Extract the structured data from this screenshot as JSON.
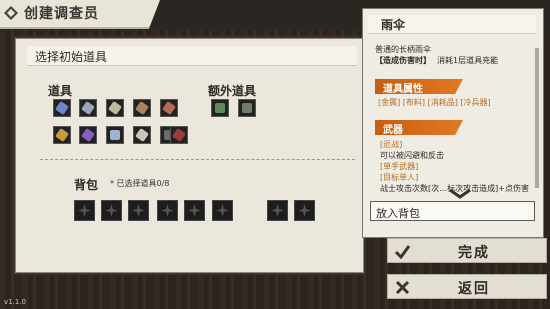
{
  "header": {
    "title": "创建调查员"
  },
  "left_panel": {
    "heading": "选择初始道具",
    "items_label": "道具",
    "extra_label": "额外道具",
    "bag_label": "背包",
    "bag_count": "* 已选择道具0/8"
  },
  "detail": {
    "name": "雨伞",
    "description": "普通的长柄雨伞",
    "effect_tag": "【造成伤害时】",
    "effect_text": "消耗1层道具充能",
    "attr_heading": "道具属性",
    "attr_tags": "[金属] [布料] [消耗品] [冷兵器]",
    "weapon_heading": "武器",
    "range_tag": "[近战]",
    "range_text": "可以被闪避和反击",
    "hand_tag": "[单手武器]",
    "target_tag": "[目标单人]",
    "partial_text": "战士攻击次数[次…标次攻击造成]+点伤害",
    "add_button": "放入背包"
  },
  "buttons": {
    "finish": "完成",
    "back": "返回"
  },
  "version": "v1.1.0",
  "icons": {
    "title": "diamond-icon",
    "slot": "four-point-star-icon",
    "finish": "check-icon",
    "back": "cross-icon",
    "scroll": "chevron-down-icon"
  },
  "colors": {
    "accent": "#d06a1a",
    "panel": "#ebe7dd"
  }
}
